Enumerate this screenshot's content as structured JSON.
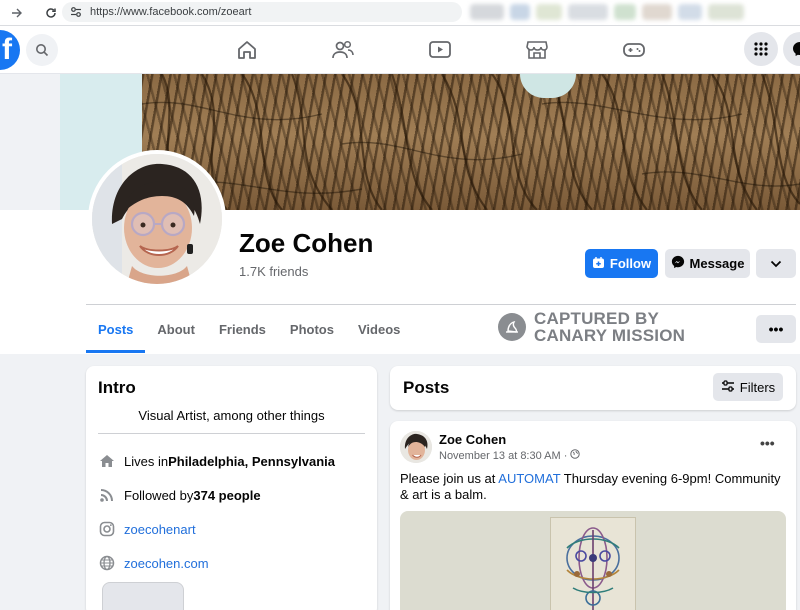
{
  "browser": {
    "url": "https://www.facebook.com/zoeart"
  },
  "profile": {
    "name": "Zoe Cohen",
    "friends": "1.7K friends",
    "follow_label": "Follow",
    "message_label": "Message"
  },
  "tabs": [
    "Posts",
    "About",
    "Friends",
    "Photos",
    "Videos"
  ],
  "watermark": {
    "line1": "CAPTURED BY",
    "line2": "CANARY MISSION"
  },
  "intro": {
    "title": "Intro",
    "bio": "Visual Artist, among other things",
    "lives_prefix": "Lives in ",
    "lives_city": "Philadelphia, Pennsylvania",
    "followed_prefix": "Followed by ",
    "followed_count": "374 people",
    "instagram": "zoecohenart",
    "website": "zoecohen.com"
  },
  "posts_section": {
    "title": "Posts",
    "filters_label": "Filters"
  },
  "post": {
    "author": "Zoe Cohen",
    "time": "November 13 at 8:30 AM ·",
    "text_before": "Please join us at ",
    "text_link": "AUTOMAT",
    "text_after": " Thursday evening 6-9pm! Community & art is a balm."
  },
  "colors": {
    "brand": "#1877f2",
    "link": "#216fdb",
    "background": "#f0f2f5"
  }
}
